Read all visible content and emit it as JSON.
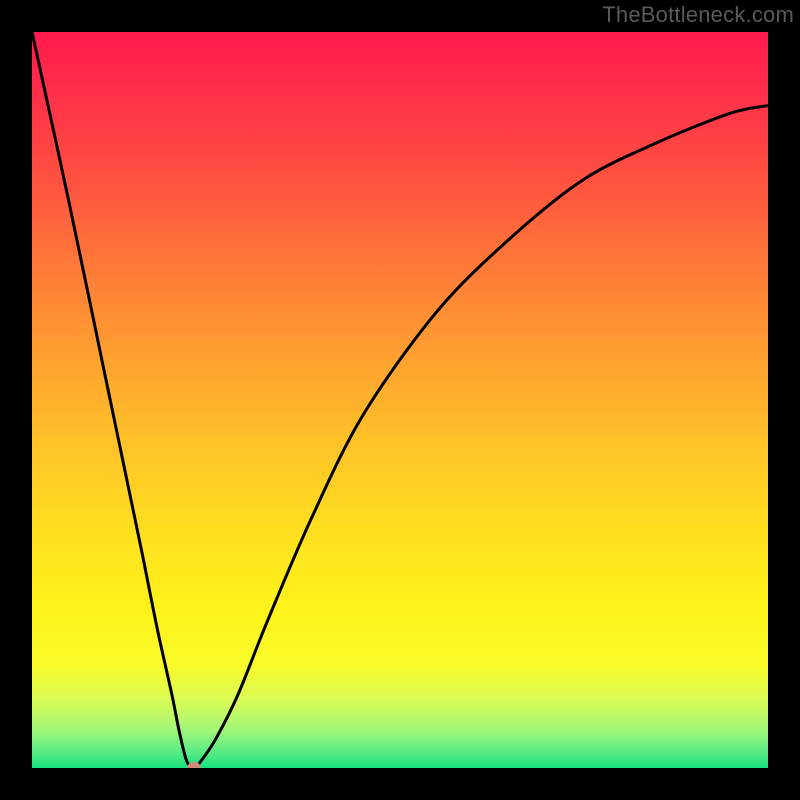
{
  "watermark": {
    "text": "TheBottleneck.com"
  },
  "colors": {
    "frame": "#000000",
    "watermark": "#5a5a5a",
    "curve": "#000000",
    "marker": "#d08a7a",
    "gradient_top": "#ff1a4d",
    "gradient_bottom": "#18e07e"
  },
  "chart_data": {
    "type": "line",
    "title": "",
    "xlabel": "",
    "ylabel": "",
    "xlim": [
      0,
      100
    ],
    "ylim": [
      0,
      100
    ],
    "grid": false,
    "legend": false,
    "series": [
      {
        "name": "bottleneck-curve",
        "x": [
          0,
          5,
          10,
          15,
          17,
          19,
          20,
          21,
          22,
          23,
          25,
          28,
          32,
          38,
          45,
          55,
          65,
          75,
          85,
          95,
          100
        ],
        "y": [
          100,
          77,
          53,
          29,
          19,
          10,
          5,
          1,
          0,
          1,
          4,
          10,
          20,
          34,
          48,
          62,
          72,
          80,
          85,
          89,
          90
        ]
      }
    ],
    "annotations": [
      {
        "name": "min-marker",
        "x": 22,
        "y": 0,
        "shape": "ellipse",
        "color": "#d08a7a"
      }
    ]
  }
}
